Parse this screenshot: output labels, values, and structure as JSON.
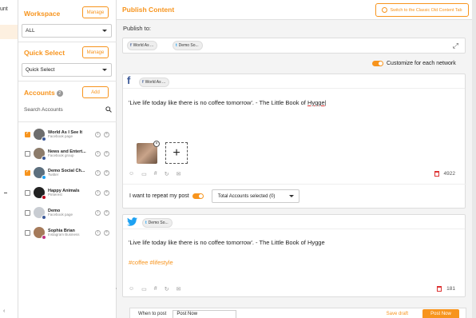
{
  "left_strip": {
    "label_fragment": "unt"
  },
  "sidebar": {
    "workspace": {
      "title": "Workspace",
      "manage_label": "Manage",
      "selected": "ALL"
    },
    "quick_select": {
      "title": "Quick Select",
      "manage_label": "Manage",
      "selected": "Quick Select"
    },
    "accounts": {
      "title": "Accounts",
      "count": "2",
      "add_label": "Add",
      "search_placeholder": "Search Accounts",
      "items": [
        {
          "name": "World As I See It",
          "type": "Facebook page",
          "checked": true,
          "network": "facebook"
        },
        {
          "name": "News and Entert...",
          "type": "Facebook group",
          "checked": false,
          "network": "facebook"
        },
        {
          "name": "Demo Social Ch...",
          "type": "Twitter",
          "checked": true,
          "network": "twitter"
        },
        {
          "name": "Happy Animals",
          "type": "Pinterest",
          "checked": false,
          "network": "pinterest"
        },
        {
          "name": "Demo",
          "type": "Facebook page",
          "checked": false,
          "network": "facebook"
        },
        {
          "name": "Sophia Brian",
          "type": "Instagram Business",
          "checked": false,
          "network": "instagram"
        }
      ]
    }
  },
  "main": {
    "title": "Publish Content",
    "classic_button": "Switch to the Classic Old Content Tab",
    "publish_to_label": "Publish to:",
    "chips": [
      "World As ...",
      "Demo So..."
    ],
    "customize_label": "Customize for each network",
    "facebook_card": {
      "chip": "World As ...",
      "text_before": "'Live life today like there is no coffee tomorrow'. - The Little Book of ",
      "text_underlined": "Hygge",
      "char_count": "4922",
      "repeat_label": "I want to repeat my post",
      "accounts_selected": "Total Accounts selected (0)"
    },
    "twitter_card": {
      "chip": "Demo So...",
      "text": "'Live life today like there is no coffee tomorrow'. - The Little Book of Hygge",
      "hashtags": "#coffee #lifestyle",
      "char_count": "181"
    },
    "bottom": {
      "when_label": "When to post",
      "when_value": "Post Now",
      "save_draft": "Save draft",
      "post_now": "Post Now"
    }
  },
  "colors": {
    "accent": "#f7941d",
    "facebook": "#3b5998",
    "twitter": "#1da1f2",
    "pinterest": "#bd081c"
  }
}
